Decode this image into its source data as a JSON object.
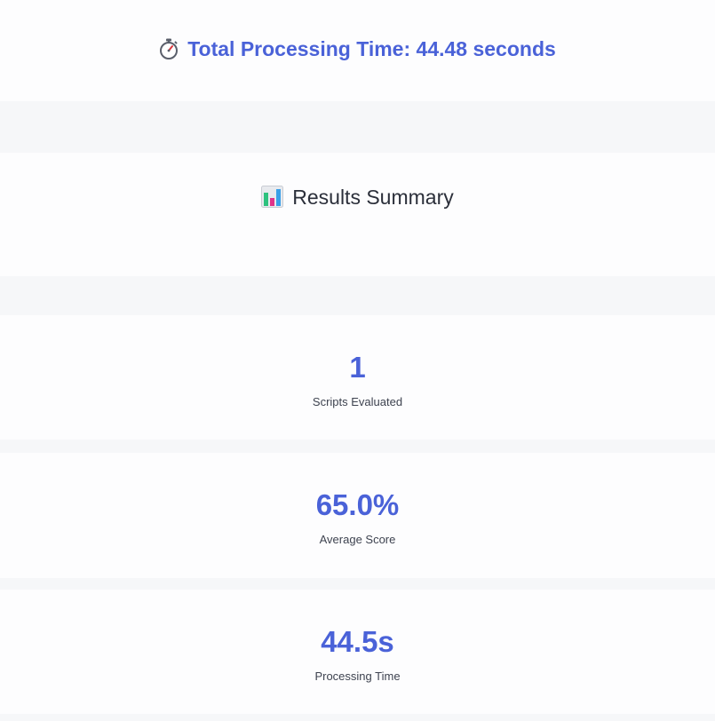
{
  "processing": {
    "icon": "stopwatch-icon",
    "text": "Total Processing Time: 44.48 seconds"
  },
  "summary": {
    "icon": "bar-chart-icon",
    "title": "Results Summary"
  },
  "metrics": [
    {
      "value": "1",
      "label": "Scripts Evaluated"
    },
    {
      "value": "65.0%",
      "label": "Average Score"
    },
    {
      "value": "44.5s",
      "label": "Processing Time"
    }
  ],
  "colors": {
    "accent": "#4a62d8",
    "card_background": "#fdfdfe",
    "page_background": "#f6f7f9",
    "text_dark": "#2b2f3a"
  }
}
